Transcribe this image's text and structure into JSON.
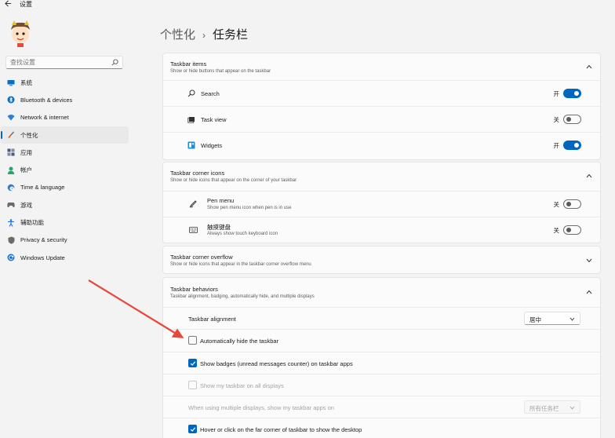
{
  "app": {
    "title": "设置",
    "back_icon": "back-arrow-icon"
  },
  "sidebar": {
    "search_placeholder": "查找设置",
    "items": [
      {
        "label": "系统",
        "icon": "monitor-icon",
        "color": "#0a6fc2"
      },
      {
        "label": "Bluetooth & devices",
        "icon": "bluetooth-icon",
        "color": "#0a6fc2"
      },
      {
        "label": "Network & internet",
        "icon": "wifi-icon",
        "color": "#2c7fd6"
      },
      {
        "label": "个性化",
        "icon": "brush-icon",
        "color": "#d87a30",
        "active": true
      },
      {
        "label": "应用",
        "icon": "apps-icon",
        "color": "#4a5a7a"
      },
      {
        "label": "帐户",
        "icon": "person-icon",
        "color": "#2aa36b"
      },
      {
        "label": "Time & language",
        "icon": "globe-clock-icon",
        "color": "#2c7fd6"
      },
      {
        "label": "游戏",
        "icon": "gamepad-icon",
        "color": "#6b6b6b"
      },
      {
        "label": "辅助功能",
        "icon": "accessibility-icon",
        "color": "#1d6fd6"
      },
      {
        "label": "Privacy & security",
        "icon": "shield-icon",
        "color": "#6b6b6b"
      },
      {
        "label": "Windows Update",
        "icon": "update-icon",
        "color": "#1d6fd6"
      }
    ]
  },
  "header": {
    "parent": "个性化",
    "separator": "›",
    "current": "任务栏"
  },
  "taskbar_items": {
    "title": "Taskbar items",
    "subtitle": "Show or hide buttons that appear on the taskbar",
    "rows": [
      {
        "label": "Search",
        "icon": "search-icon",
        "state": "开",
        "on": true
      },
      {
        "label": "Task view",
        "icon": "task-view-icon",
        "state": "关",
        "on": false
      },
      {
        "label": "Widgets",
        "icon": "widgets-icon",
        "state": "开",
        "on": true
      }
    ]
  },
  "corner_icons": {
    "title": "Taskbar corner icons",
    "subtitle": "Show or hide icons that appear on the corner of your taskbar",
    "rows": [
      {
        "label": "Pen menu",
        "sub": "Show pen menu icon when pen is in use",
        "icon": "pen-icon",
        "state": "关",
        "on": false
      },
      {
        "label": "触摸键盘",
        "sub": "Always show touch keyboard icon",
        "icon": "keyboard-icon",
        "state": "关",
        "on": false
      }
    ]
  },
  "corner_overflow": {
    "title": "Taskbar corner overflow",
    "subtitle": "Show or hide icons that appear in the taskbar corner overflow menu"
  },
  "behaviors": {
    "title": "Taskbar behaviors",
    "subtitle": "Taskbar alignment, badging, automatically hide, and multiple displays",
    "alignment_label": "Taskbar alignment",
    "alignment_value": "居中",
    "auto_hide": {
      "label": "Automatically hide the taskbar",
      "checked": false
    },
    "badges": {
      "label": "Show badges (unread messages counter) on taskbar apps",
      "checked": true
    },
    "all_displays": {
      "label": "Show my taskbar on all displays",
      "checked": false,
      "disabled": true
    },
    "multi_display_label": "When using multiple displays, show my taskbar apps on",
    "multi_display_value": "所有任务栏",
    "corner_click": {
      "label": "Hover or click on the far corner of taskbar to show the desktop",
      "checked": true
    }
  },
  "colors": {
    "accent": "#0067c0",
    "annotation_arrow": "#e8483a"
  }
}
